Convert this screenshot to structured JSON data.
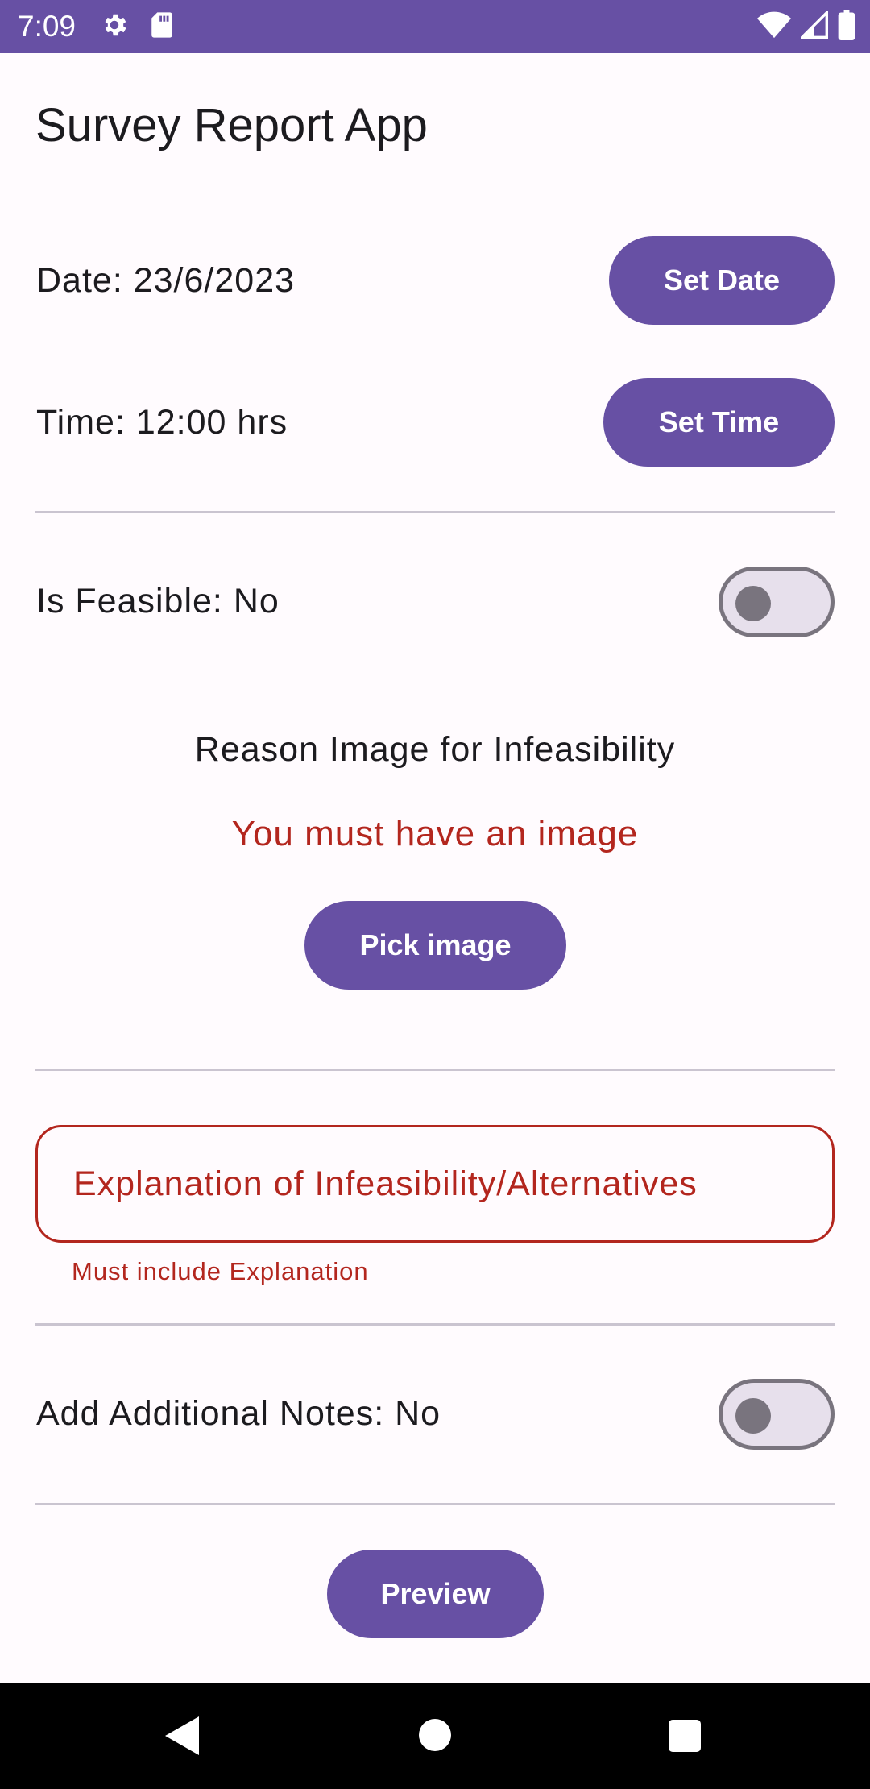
{
  "status_bar": {
    "time": "7:09",
    "icons_left": [
      "gear-icon",
      "sd-card-icon"
    ],
    "icons_right": [
      "wifi-icon",
      "signal-icon",
      "battery-icon"
    ],
    "background": "#6750a4"
  },
  "app": {
    "title": "Survey Report App"
  },
  "date_row": {
    "label": "Date: 23/6/2023",
    "button": "Set Date"
  },
  "time_row": {
    "label": "Time: 12:00 hrs",
    "button": "Set Time"
  },
  "feasible_row": {
    "label": "Is Feasible: No",
    "switch_on": false
  },
  "reason_image": {
    "title": "Reason Image for Infeasibility",
    "error": "You must have an image",
    "button": "Pick image"
  },
  "explanation_field": {
    "placeholder": "Explanation of Infeasibility/Alternatives",
    "value": "",
    "error": "Must include Explanation"
  },
  "notes_row": {
    "label": "Add Additional Notes: No",
    "switch_on": false
  },
  "preview": {
    "button": "Preview"
  },
  "nav_bar": {
    "icons": [
      "back-icon",
      "home-icon",
      "recents-icon"
    ]
  },
  "colors": {
    "primary": "#6750a4",
    "error": "#b3261e",
    "outline": "#79747e",
    "surface": "#fffbfe",
    "switch_track": "#e7e0ec"
  }
}
